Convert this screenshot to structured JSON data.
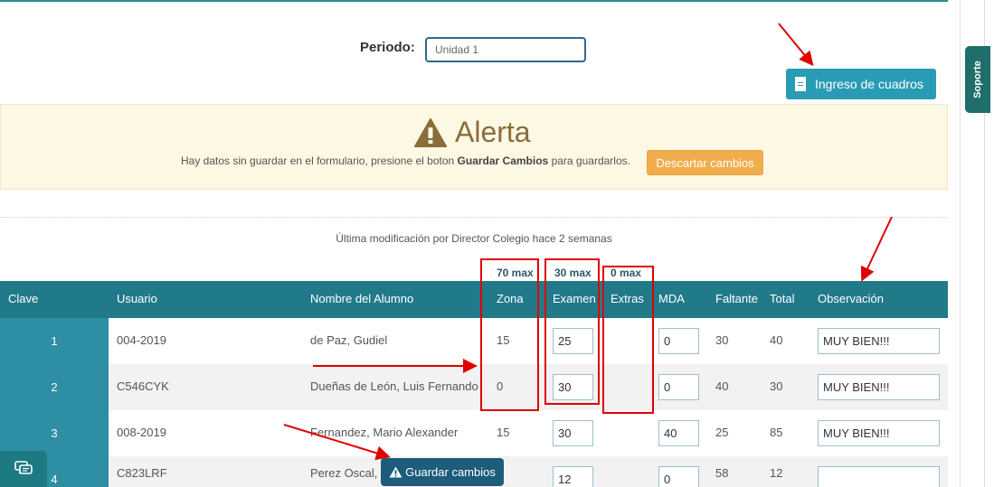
{
  "periodo": {
    "label": "Periodo:",
    "value": "Unidad 1"
  },
  "header": {
    "ingreso_label": "Ingreso de cuadros",
    "soporte_label": "Soporte"
  },
  "alert": {
    "title": "Alerta",
    "message_pre": "Hay datos sin guardar en el formulario, presione el boton",
    "message_bold": "Guardar Cambios",
    "message_post": "para guardarlos.",
    "discard_label": "Descartar cambios"
  },
  "last_modified": "Última modificación por Director Colegio hace 2 semanas",
  "max_labels": {
    "zona": "70 max",
    "examen": "30 max",
    "extras": "0 max"
  },
  "table": {
    "headers": [
      "Clave",
      "Usuario",
      "Nombre del Alumno",
      "Zona",
      "Examen",
      "Extras",
      "MDA",
      "Faltante",
      "Total",
      "Observación"
    ],
    "rows": [
      {
        "clave": "1",
        "usuario": "004-2019",
        "nombre": "de Paz, Gudiel",
        "zona": "15",
        "examen": "25",
        "extras": "",
        "mda": "0",
        "faltante": "30",
        "total": "40",
        "observacion": "MUY BIEN!!!"
      },
      {
        "clave": "2",
        "usuario": "C546CYK",
        "nombre": "Dueñas de León, Luis Fernando",
        "zona": "0",
        "examen": "30",
        "extras": "",
        "mda": "0",
        "faltante": "40",
        "total": "30",
        "observacion": "MUY BIEN!!!"
      },
      {
        "clave": "3",
        "usuario": "008-2019",
        "nombre": "Fernandez, Mario Alexander",
        "zona": "15",
        "examen": "30",
        "extras": "",
        "mda": "40",
        "faltante": "25",
        "total": "85",
        "observacion": "MUY BIEN!!!"
      },
      {
        "clave": "4",
        "usuario": "C823LRF",
        "nombre": "Perez Oscal, C",
        "zona": "",
        "examen": "12",
        "extras": "",
        "mda": "0",
        "faltante": "58",
        "total": "12",
        "observacion": ""
      }
    ]
  },
  "guardar_label": "Guardar cambios",
  "colors": {
    "header": "#217a8a",
    "clave": "#2e8ea3",
    "alert_bg": "#fcf8e3",
    "warning": "#f0ad4e",
    "annotation": "#e00000"
  }
}
